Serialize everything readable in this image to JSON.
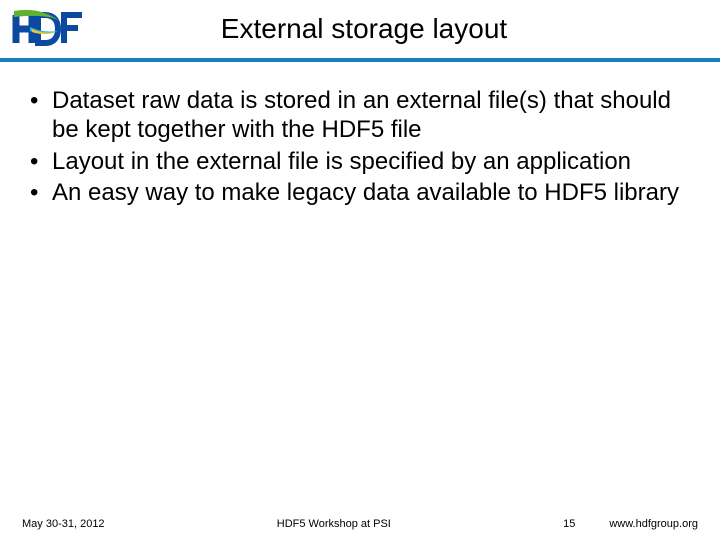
{
  "header": {
    "title": "External storage layout",
    "logo_label": "HDF"
  },
  "bullets": [
    "Dataset raw data is stored in an external file(s) that should be kept together with the HDF5 file",
    "Layout in the external file is specified by an application",
    "An easy way to make legacy data available to HDF5 library"
  ],
  "footer": {
    "date": "May 30-31, 2012",
    "center": "HDF5 Workshop at PSI",
    "page": "15",
    "url": "www.hdfgroup.org"
  },
  "colors": {
    "rule": "#1a7fc0"
  }
}
